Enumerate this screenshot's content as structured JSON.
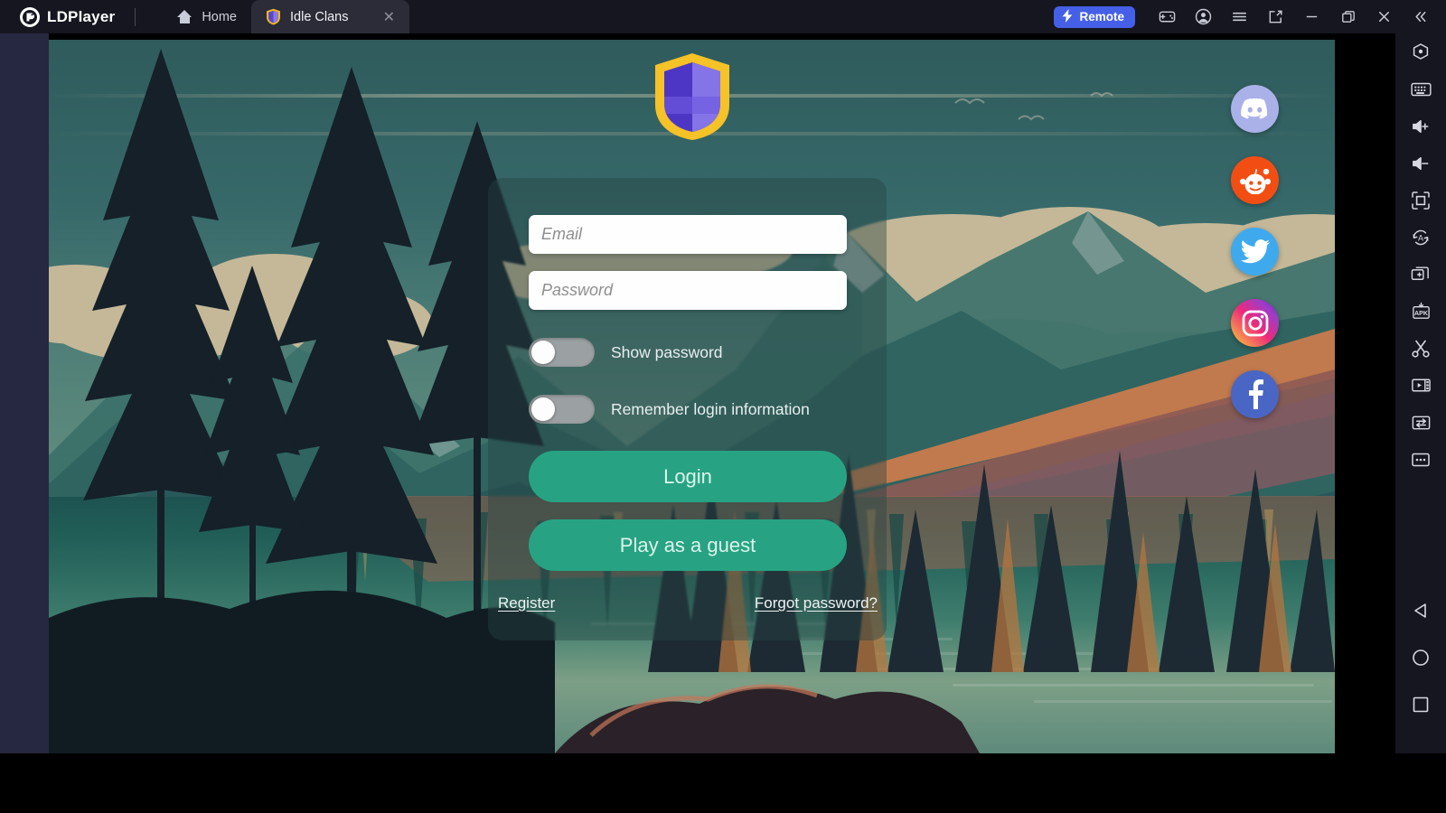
{
  "window": {
    "brand": "LDPlayer",
    "brand_icon": "ldplayer-logo-icon",
    "tabs": [
      {
        "label": "Home",
        "icon": "home-icon",
        "active": false
      },
      {
        "label": "Idle Clans",
        "icon": "idle-clans-shield-icon",
        "active": true,
        "close": "✕"
      }
    ],
    "controls": {
      "remote_label": "Remote",
      "remote_icon": "bolt-icon",
      "remote_color": "#4560e6",
      "gamepad_icon": "gamepad-icon",
      "account_icon": "account-circle-icon",
      "menu_icon": "hamburger-menu-icon",
      "multi_instance_icon": "new-window-icon",
      "minimize_icon": "minimize-icon",
      "maximize_icon": "restore-window-icon",
      "close_icon": "close-icon",
      "collapse_icon": "double-chevron-left-icon"
    }
  },
  "right_toolbar": {
    "items": [
      {
        "name": "settings-hexagon-icon",
        "label": "Settings"
      },
      {
        "name": "keyboard-icon",
        "label": "Keyboard mapping"
      },
      {
        "name": "volume-up-icon",
        "label": "Volume up"
      },
      {
        "name": "volume-down-icon",
        "label": "Volume down"
      },
      {
        "name": "fullscreen-icon",
        "label": "Full screen"
      },
      {
        "name": "auto-rotate-icon",
        "label": "Rotate"
      },
      {
        "name": "multi-instance-icon",
        "label": "Multi instance"
      },
      {
        "name": "apk-install-icon",
        "label": "APK"
      },
      {
        "name": "screenshot-scissors-icon",
        "label": "Screenshot"
      },
      {
        "name": "video-record-icon",
        "label": "Record"
      },
      {
        "name": "shake-sync-icon",
        "label": "Synchronizer"
      },
      {
        "name": "more-options-icon",
        "label": "More"
      }
    ],
    "nav": [
      {
        "name": "android-back-icon",
        "label": "Back"
      },
      {
        "name": "android-home-icon",
        "label": "Home"
      },
      {
        "name": "android-recents-icon",
        "label": "Recents"
      }
    ]
  },
  "game": {
    "logo_icon": "idle-clans-shield-logo",
    "form": {
      "email_placeholder": "Email",
      "email_value": "",
      "password_placeholder": "Password",
      "password_value": "",
      "show_password_label": "Show password",
      "show_password_on": false,
      "remember_label": "Remember login information",
      "remember_on": false,
      "login_label": "Login",
      "guest_label": "Play as a guest",
      "register_label": "Register",
      "forgot_label": "Forgot password?",
      "button_color": "#27a383"
    },
    "social": [
      {
        "name": "discord-icon",
        "label": "Discord",
        "color": "#aab1e8"
      },
      {
        "name": "reddit-icon",
        "label": "Reddit",
        "color": "#f24e13"
      },
      {
        "name": "twitter-icon",
        "label": "Twitter",
        "color": "#3fa9ee"
      },
      {
        "name": "instagram-icon",
        "label": "Instagram",
        "color": "#ee2a7b"
      },
      {
        "name": "facebook-icon",
        "label": "Facebook",
        "color": "#4a66c4"
      }
    ]
  }
}
